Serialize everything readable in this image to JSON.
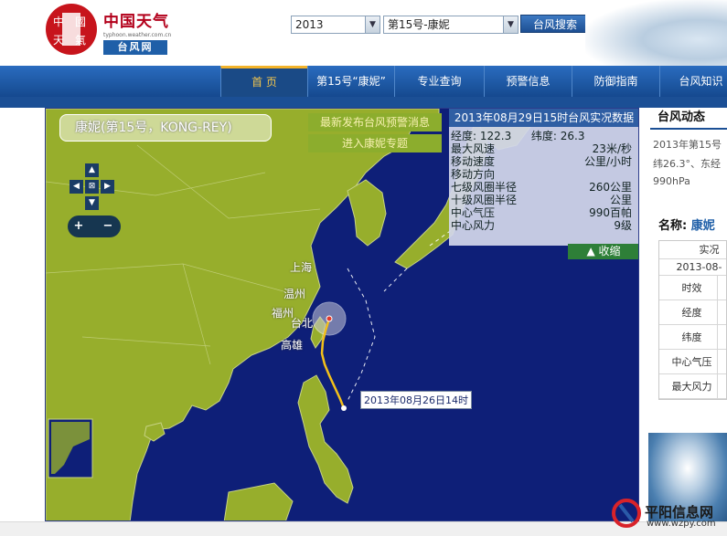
{
  "header": {
    "logo_seal_text": "中國天氣",
    "logo_name": "中国天气",
    "logo_url": "typhoon.weather.com.cn",
    "logo_sub": "台风网",
    "year_value": "2013",
    "typhoon_value": "第15号-康妮",
    "search_label": "台风搜索"
  },
  "nav": {
    "items": [
      {
        "label": "首 页"
      },
      {
        "label": "第15号“康妮”"
      },
      {
        "label": "专业查询"
      },
      {
        "label": "预警信息"
      },
      {
        "label": "防御指南"
      },
      {
        "label": "台风知识"
      }
    ]
  },
  "map": {
    "typhoon_title": "康妮(第15号，KONG-REY)",
    "warn_link_1": "最新发布台风预警消息",
    "warn_link_2": "进入康妮专题",
    "cities": [
      "上海",
      "温州",
      "福州",
      "台北",
      "高雄"
    ],
    "track_start_label": "2013年08月26日14时",
    "info": {
      "heading": "2013年08月29日15时台风实况数据",
      "lon_label": "经度:",
      "lon_value": "122.3",
      "lat_label": "纬度:",
      "lat_value": "26.3",
      "rows": [
        {
          "label": "最大风速",
          "value": "23米/秒"
        },
        {
          "label": "移动速度",
          "value": "公里/小时"
        },
        {
          "label": "移动方向",
          "value": ""
        },
        {
          "label": "七级风圈半径",
          "value": "260公里"
        },
        {
          "label": "十级风圈半径",
          "value": "公里"
        },
        {
          "label": "中心气压",
          "value": "990百帕"
        },
        {
          "label": "中心风力",
          "value": "9级"
        }
      ],
      "collapse_label": "▲ 收缩"
    },
    "zoom_in": "+",
    "zoom_out": "−"
  },
  "right": {
    "dynamics_title": "台风动态",
    "dynamics_line1": "2013年第15号",
    "dynamics_line2": "纬26.3°、东经",
    "dynamics_line3": "990hPa",
    "name_label": "名称: ",
    "name_value": "康妮",
    "table_header": "实况",
    "table_date": "2013-08-",
    "table_rows": [
      "时效",
      "经度",
      "纬度",
      "中心气压",
      "最大风力"
    ]
  },
  "watermark": {
    "brand": "平阳信息网",
    "url": "www.wzpy.com"
  },
  "colors": {
    "land": "#97ae2c",
    "sea": "#0e1f78",
    "nav": "#1f5fa8",
    "accent": "#f3b32a"
  }
}
